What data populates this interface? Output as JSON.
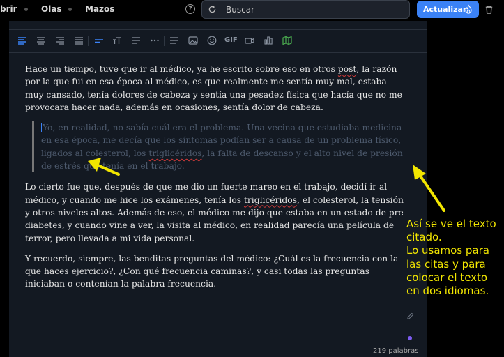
{
  "nav": {
    "items": [
      {
        "label": "brir"
      },
      {
        "label": "Olas"
      },
      {
        "label": "Mazos"
      }
    ]
  },
  "search": {
    "placeholder": "Buscar"
  },
  "header": {
    "update_label": "Actualizar"
  },
  "toolbar": {
    "gif_label": "GIF"
  },
  "document": {
    "paragraph1_a": "Hace un tiempo, tuve que ir al médico, ya he escrito sobre eso en otros ",
    "paragraph1_b": "post",
    "paragraph1_c": ", la razón por la que fui en esa época al médico, es que realmente me sentía muy mal, estaba muy cansado, tenía dolores de cabeza y sentía una pesadez física que hacía que no me provocara hacer nada, además en ocasiones, sentía dolor de cabeza.",
    "quote_a": "Yo, en realidad, no sabía cuál era el problema. Una vecina que estudiaba medicina en esa época, me decía que los síntomas podían ser a causa de un problema físico, ligados al colesterol, los ",
    "quote_b": "triglicéridos",
    "quote_c": ", la falta de descanso y el alto nivel de presión de estrés que tenía en el trabajo.",
    "paragraph2_a": "Lo cierto fue que, después de que me dio un fuerte mareo en el trabajo, decidí ir al médico, y cuando me hice los exámenes, tenía los ",
    "paragraph2_b": "triglicéridos",
    "paragraph2_c": ", el colesterol, la tensión y otros niveles altos. Además de eso, el médico me dijo que estaba en un estado de pre diabetes, y cuando vine a ver, la visita al médico, en realidad parecía una película de terror, pero llevada a mi vida personal.",
    "paragraph3": "Y recuerdo, siempre, las benditas preguntas del médico: ¿Cuál es la frecuencia con la que haces ejercicio?, ¿Con qué frecuencia caminas?, y casi todas las preguntas iniciaban o contenían la palabra frecuencia.",
    "word_count": "219 palabras"
  },
  "annotation": {
    "lines": [
      "Así se ve el texto",
      "citado.",
      "Lo usamos para",
      "las citas y para",
      "colocar el texto",
      "en dos idiomas."
    ],
    "color": "#f2e600"
  },
  "colors": {
    "accent": "#3b82f6",
    "editor_bg": "#131922",
    "quote_text": "#4d5a6d"
  }
}
